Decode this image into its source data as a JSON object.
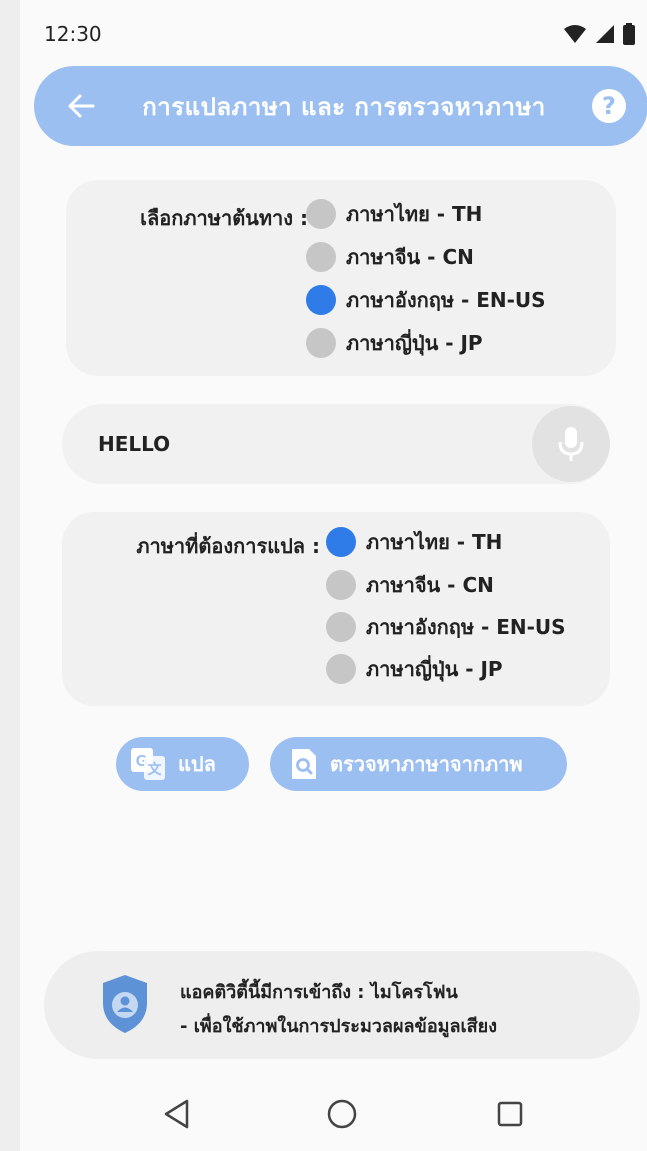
{
  "status_bar": {
    "time": "12:30",
    "icons": [
      "wifi-icon",
      "signal-icon",
      "battery-icon"
    ]
  },
  "app_bar": {
    "title": "การแปลภาษา และ การตรวจหาภาษา",
    "back_icon": "arrow-left-icon",
    "help_icon": "question-icon",
    "help_glyph": "?",
    "color": "#9cbff2"
  },
  "source_language": {
    "label": "เลือกภาษาต้นทาง :",
    "options": [
      {
        "label": "ภาษาไทย - TH",
        "selected": false
      },
      {
        "label": "ภาษาจีน - CN",
        "selected": false
      },
      {
        "label": "ภาษาอังกฤษ - EN-US",
        "selected": true
      },
      {
        "label": "ภาษาญี่ปุ่น - JP",
        "selected": false
      }
    ]
  },
  "input": {
    "value": "HELLO",
    "mic_icon": "microphone-icon"
  },
  "target_language": {
    "label": "ภาษาที่ต้องการแปล :",
    "options": [
      {
        "label": "ภาษาไทย - TH",
        "selected": true
      },
      {
        "label": "ภาษาจีน - CN",
        "selected": false
      },
      {
        "label": "ภาษาอังกฤษ - EN-US",
        "selected": false
      },
      {
        "label": "ภาษาญี่ปุ่น - JP",
        "selected": false
      }
    ]
  },
  "buttons": {
    "translate_label": "แปล",
    "translate_icon": "google-translate-icon",
    "detect_label": "ตรวจหาภาษาจากภาพ",
    "detect_icon": "image-search-icon"
  },
  "notice": {
    "line1": "แอคติวิตี้นี้มีการเข้าถึง : ไมโครโฟน",
    "line2": "- เพื่อใช้ภาพในการประมวลผลข้อมูลเสียง",
    "icon": "shield-user-icon"
  },
  "nav_bar": {
    "icons": [
      "back-triangle-icon",
      "home-circle-icon",
      "recents-square-icon"
    ]
  },
  "colors": {
    "accent": "#9cbff2",
    "radio_selected": "#2f7be8",
    "radio_unselected": "#c6c6c6"
  }
}
